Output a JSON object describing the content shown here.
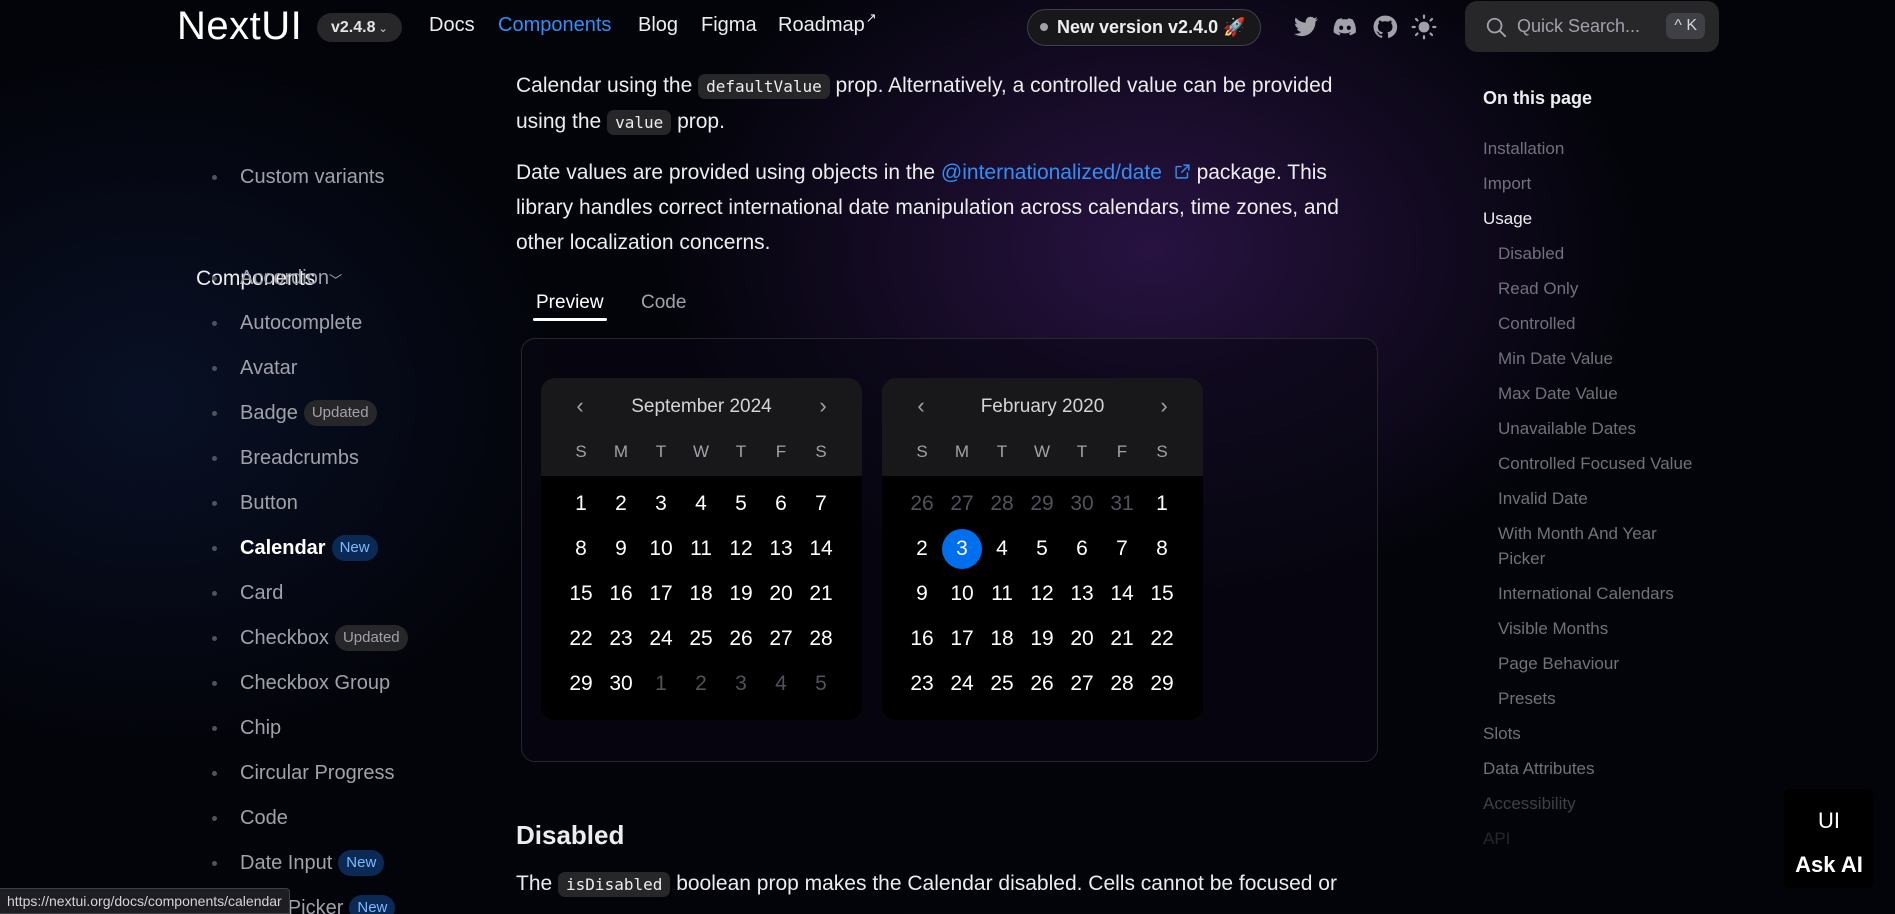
{
  "navbar": {
    "logo": "NextUI",
    "version": "v2.4.8",
    "links": [
      "Docs",
      "Components",
      "Blog",
      "Figma",
      "Roadmap"
    ],
    "roadmap_sup": "↗",
    "new_version": "New version v2.4.0 🚀",
    "icons": [
      "twitter-icon",
      "discord-icon",
      "github-icon",
      "theme-toggle-icon",
      "search-icon"
    ],
    "search_placeholder": "Quick Search...",
    "search_shortcut": "^ K",
    "accent": "#338ef7"
  },
  "sidebar": {
    "top_item": "Custom variants",
    "section": "Components",
    "items": [
      {
        "label": "Accordion",
        "badge": ""
      },
      {
        "label": "Autocomplete",
        "badge": ""
      },
      {
        "label": "Avatar",
        "badge": ""
      },
      {
        "label": "Badge",
        "badge": "Updated"
      },
      {
        "label": "Breadcrumbs",
        "badge": ""
      },
      {
        "label": "Button",
        "badge": ""
      },
      {
        "label": "Calendar",
        "badge": "New"
      },
      {
        "label": "Card",
        "badge": ""
      },
      {
        "label": "Checkbox",
        "badge": "Updated"
      },
      {
        "label": "Checkbox Group",
        "badge": ""
      },
      {
        "label": "Chip",
        "badge": ""
      },
      {
        "label": "Circular Progress",
        "badge": ""
      },
      {
        "label": "Code",
        "badge": ""
      },
      {
        "label": "Date Input",
        "badge": "New"
      },
      {
        "label": "Date Picker",
        "badge": "New"
      }
    ]
  },
  "content": {
    "p1_a": "Calendar using the ",
    "p1_code1": "defaultValue",
    "p1_b": " prop. Alternatively, a controlled value can be provided",
    "p1_c": "using the ",
    "p1_code2": "value",
    "p1_d": " prop.",
    "p2_a": "Date values are provided using objects in the ",
    "p2_link": "@internationalized/date",
    "p2_b": " package. This",
    "p2_c": "library handles correct international date manipulation across calendars, time zones, and",
    "p2_d": "other localization concerns.",
    "tabs": [
      "Preview",
      "Code"
    ],
    "heading": "Disabled",
    "p3_a": "The ",
    "p3_code": "isDisabled",
    "p3_b": " boolean prop makes the Calendar disabled. Cells cannot be focused or"
  },
  "calendars": [
    {
      "title": "September 2024",
      "weekdays": [
        "S",
        "M",
        "T",
        "W",
        "T",
        "F",
        "S"
      ],
      "days": [
        [
          "1",
          ""
        ],
        [
          "2",
          ""
        ],
        [
          "3",
          ""
        ],
        [
          "4",
          ""
        ],
        [
          "5",
          ""
        ],
        [
          "6",
          ""
        ],
        [
          "7",
          ""
        ],
        [
          "8",
          ""
        ],
        [
          "9",
          ""
        ],
        [
          "10",
          ""
        ],
        [
          "11",
          ""
        ],
        [
          "12",
          ""
        ],
        [
          "13",
          ""
        ],
        [
          "14",
          ""
        ],
        [
          "15",
          ""
        ],
        [
          "16",
          ""
        ],
        [
          "17",
          ""
        ],
        [
          "18",
          ""
        ],
        [
          "19",
          ""
        ],
        [
          "20",
          ""
        ],
        [
          "21",
          ""
        ],
        [
          "22",
          ""
        ],
        [
          "23",
          ""
        ],
        [
          "24",
          ""
        ],
        [
          "25",
          ""
        ],
        [
          "26",
          ""
        ],
        [
          "27",
          ""
        ],
        [
          "28",
          ""
        ],
        [
          "29",
          ""
        ],
        [
          "30",
          ""
        ],
        [
          "1",
          "out"
        ],
        [
          "2",
          "out"
        ],
        [
          "3",
          "out"
        ],
        [
          "4",
          "out"
        ],
        [
          "5",
          "out"
        ]
      ]
    },
    {
      "title": "February 2020",
      "weekdays": [
        "S",
        "M",
        "T",
        "W",
        "T",
        "F",
        "S"
      ],
      "days": [
        [
          "26",
          "out"
        ],
        [
          "27",
          "out"
        ],
        [
          "28",
          "out"
        ],
        [
          "29",
          "out"
        ],
        [
          "30",
          "out"
        ],
        [
          "31",
          "out"
        ],
        [
          "1",
          ""
        ],
        [
          "2",
          ""
        ],
        [
          "3",
          "sel"
        ],
        [
          "4",
          ""
        ],
        [
          "5",
          ""
        ],
        [
          "6",
          ""
        ],
        [
          "7",
          ""
        ],
        [
          "8",
          ""
        ],
        [
          "9",
          ""
        ],
        [
          "10",
          ""
        ],
        [
          "11",
          ""
        ],
        [
          "12",
          ""
        ],
        [
          "13",
          ""
        ],
        [
          "14",
          ""
        ],
        [
          "15",
          ""
        ],
        [
          "16",
          ""
        ],
        [
          "17",
          ""
        ],
        [
          "18",
          ""
        ],
        [
          "19",
          ""
        ],
        [
          "20",
          ""
        ],
        [
          "21",
          ""
        ],
        [
          "22",
          ""
        ],
        [
          "23",
          ""
        ],
        [
          "24",
          ""
        ],
        [
          "25",
          ""
        ],
        [
          "26",
          ""
        ],
        [
          "27",
          ""
        ],
        [
          "28",
          ""
        ],
        [
          "29",
          ""
        ]
      ]
    }
  ],
  "toc": {
    "title": "On this page",
    "items": [
      {
        "label": "Installation",
        "level": 1,
        "state": ""
      },
      {
        "label": "Import",
        "level": 1,
        "state": ""
      },
      {
        "label": "Usage",
        "level": 1,
        "state": "active"
      },
      {
        "label": "Disabled",
        "level": 2,
        "state": ""
      },
      {
        "label": "Read Only",
        "level": 2,
        "state": ""
      },
      {
        "label": "Controlled",
        "level": 2,
        "state": ""
      },
      {
        "label": "Min Date Value",
        "level": 2,
        "state": ""
      },
      {
        "label": "Max Date Value",
        "level": 2,
        "state": ""
      },
      {
        "label": "Unavailable Dates",
        "level": 2,
        "state": ""
      },
      {
        "label": "Controlled Focused Value",
        "level": 2,
        "state": ""
      },
      {
        "label": "Invalid Date",
        "level": 2,
        "state": ""
      },
      {
        "label": "With Month And Year Picker",
        "level": 2,
        "state": ""
      },
      {
        "label": "International Calendars",
        "level": 2,
        "state": ""
      },
      {
        "label": "Visible Months",
        "level": 2,
        "state": ""
      },
      {
        "label": "Page Behaviour",
        "level": 2,
        "state": ""
      },
      {
        "label": "Presets",
        "level": 2,
        "state": ""
      },
      {
        "label": "Slots",
        "level": 1,
        "state": ""
      },
      {
        "label": "Data Attributes",
        "level": 1,
        "state": ""
      },
      {
        "label": "Accessibility",
        "level": 1,
        "state": "faded"
      },
      {
        "label": "API",
        "level": 1,
        "state": "faded2"
      }
    ]
  },
  "ask_ai": {
    "badge": "UI",
    "label": "Ask AI"
  },
  "status_url": "https://nextui.org/docs/components/calendar"
}
